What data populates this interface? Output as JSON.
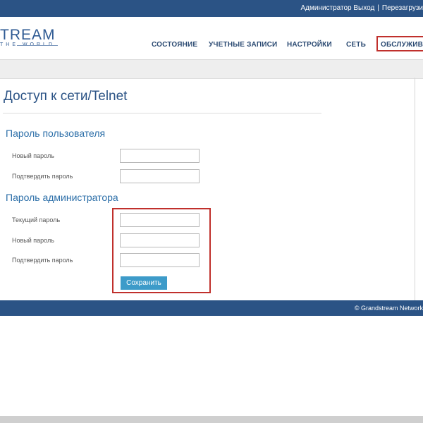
{
  "topbar": {
    "user": "Администратор",
    "logout": "Выход",
    "separator": "|",
    "reboot": "Перезагрузи"
  },
  "logo": {
    "main": "TREAM",
    "sub": "THE WORLD"
  },
  "nav": {
    "items": [
      {
        "label": "СОСТОЯНИЕ"
      },
      {
        "label": "УЧЕТНЫЕ ЗАПИСИ"
      },
      {
        "label": "НАСТРОЙКИ"
      },
      {
        "label": "СЕТЬ"
      },
      {
        "label": "ОБСЛУЖИВА",
        "active": true
      }
    ]
  },
  "page": {
    "title": "Доступ к сети/Telnet"
  },
  "user_password": {
    "title": "Пароль пользователя",
    "fields": [
      {
        "label": "Новый пароль",
        "value": ""
      },
      {
        "label": "Подтвердить пароль",
        "value": ""
      }
    ]
  },
  "admin_password": {
    "title": "Пароль администратора",
    "fields": [
      {
        "label": "Текущий пароль",
        "value": ""
      },
      {
        "label": "Новый пароль",
        "value": ""
      },
      {
        "label": "Подтвердить пароль",
        "value": ""
      }
    ]
  },
  "actions": {
    "save_label": "Сохранить"
  },
  "footer": {
    "copyright": "© Grandstream Network"
  },
  "colors": {
    "brand": "#2b5385",
    "section": "#2b6ea8",
    "button": "#3d9bc9",
    "highlight": "#c0302c"
  }
}
